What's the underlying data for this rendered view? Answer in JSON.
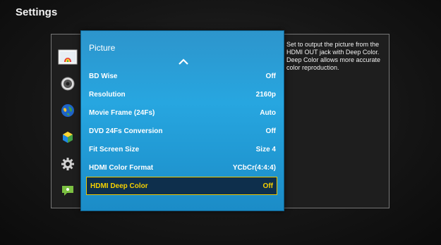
{
  "screen_title": "Settings",
  "panel": {
    "title": "Picture",
    "rows": [
      {
        "label": "BD Wise",
        "value": "Off"
      },
      {
        "label": "Resolution",
        "value": "2160p"
      },
      {
        "label": "Movie Frame (24Fs)",
        "value": "Auto"
      },
      {
        "label": "DVD 24Fs Conversion",
        "value": "Off"
      },
      {
        "label": "Fit Screen Size",
        "value": "Size 4"
      },
      {
        "label": "HDMI Color Format",
        "value": "YCbCr(4:4:4)"
      },
      {
        "label": "HDMI Deep Color",
        "value": "Off"
      }
    ],
    "selected_index": 6
  },
  "description": "Set to output the picture from the HDMI OUT jack with Deep Color. Deep Color allows more accurate color reproduction.",
  "category_icons": [
    "picture-icon",
    "sound-icon",
    "network-icon",
    "smart-features-icon",
    "settings-gear-icon",
    "support-icon"
  ],
  "colors": {
    "panel": "#27a6e0",
    "selected_bg": "#0e2f4c",
    "selected_text": "#f5d000"
  }
}
